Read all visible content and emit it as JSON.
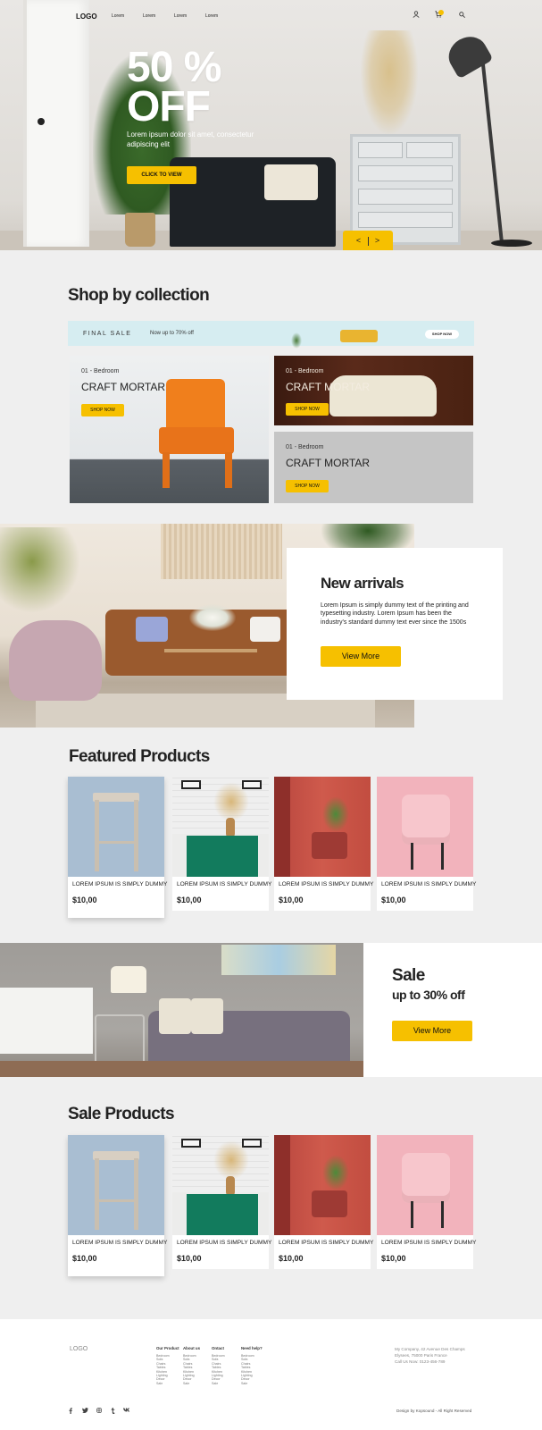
{
  "nav": {
    "logo": "LOGO",
    "links": [
      "Lorem",
      "Lorem",
      "Lorem",
      "Lorem"
    ],
    "icons": [
      "user-icon",
      "cart-icon",
      "search-icon"
    ]
  },
  "hero": {
    "big_line1": "50 %",
    "big_line2": "OFF",
    "subtitle": "Lorem ipsum dolor sit amet, consectetur adipiscing elit",
    "cta": "CLICK TO VIEW",
    "prev": "<",
    "next": ">"
  },
  "collection": {
    "title": "Shop by collection",
    "banner": {
      "label": "FINAL SALE",
      "text": "Now up to 70% off",
      "button": "SHOP NOW"
    },
    "cards": [
      {
        "category": "01 - Bedroom",
        "title": "CRAFT MORTAR",
        "button": "SHOP NOW"
      },
      {
        "category": "01 - Bedroom",
        "title": "CRAFT MORTAR",
        "button": "SHOP NOW"
      },
      {
        "category": "01 - Bedroom",
        "title": "CRAFT MORTAR",
        "button": "SHOP NOW"
      }
    ]
  },
  "new_arrivals": {
    "title": "New arrivals",
    "text": "Lorem Ipsum is simply dummy text of the printing and typesetting industry. Lorem Ipsum has been the industry's standard dummy text ever since the 1500s",
    "button": "View More"
  },
  "featured": {
    "title": "Featured Products",
    "products": [
      {
        "name": "LOREM IPSUM IS SIMPLY DUMMY",
        "price": "$10,00"
      },
      {
        "name": "LOREM IPSUM IS SIMPLY DUMMY",
        "price": "$10,00"
      },
      {
        "name": "LOREM IPSUM IS SIMPLY DUMMY",
        "price": "$10,00"
      },
      {
        "name": "LOREM IPSUM IS SIMPLY DUMMY",
        "price": "$10,00"
      }
    ]
  },
  "sale_banner": {
    "title": "Sale",
    "subtitle": "up to 30% off",
    "button": "View More"
  },
  "sale_products": {
    "title": "Sale Products",
    "products": [
      {
        "name": "LOREM IPSUM IS SIMPLY DUMMY",
        "price": "$10,00"
      },
      {
        "name": "LOREM IPSUM IS SIMPLY DUMMY",
        "price": "$10,00"
      },
      {
        "name": "LOREM IPSUM IS SIMPLY DUMMY",
        "price": "$10,00"
      },
      {
        "name": "LOREM IPSUM IS SIMPLY DUMMY",
        "price": "$10,00"
      }
    ]
  },
  "footer": {
    "logo": "LOGO",
    "columns": [
      {
        "heading": "Our Product",
        "items": [
          "Bedroom",
          "Sofa",
          "Chairs",
          "Tables",
          "Kitchen",
          "Lighting",
          "Decor",
          "Sale"
        ]
      },
      {
        "heading": "About us",
        "items": [
          "Bedroom",
          "Sofa",
          "Chairs",
          "Tables",
          "Kitchen",
          "Lighting",
          "Decor",
          "Sale"
        ]
      },
      {
        "heading": "Ontact",
        "items": [
          "Bedroom",
          "Sofa",
          "Chairs",
          "Tables",
          "Kitchen",
          "Lighting",
          "Decor",
          "Sale"
        ]
      },
      {
        "heading": "Need help?",
        "items": [
          "Bedroom",
          "Sofa",
          "Chairs",
          "Tables",
          "Kitchen",
          "Lighting",
          "Decor",
          "Sale"
        ]
      }
    ],
    "address": [
      "My Company, 42 Avenue Des Champs",
      "Elysees, 75000 Paris France",
      "Call Us Now: 0123-456-789"
    ],
    "social": [
      "facebook-icon",
      "twitter-icon",
      "instagram-icon",
      "tumblr-icon",
      "vk-icon"
    ],
    "copyright": "Design by Kopsound - All Right Reserved"
  }
}
